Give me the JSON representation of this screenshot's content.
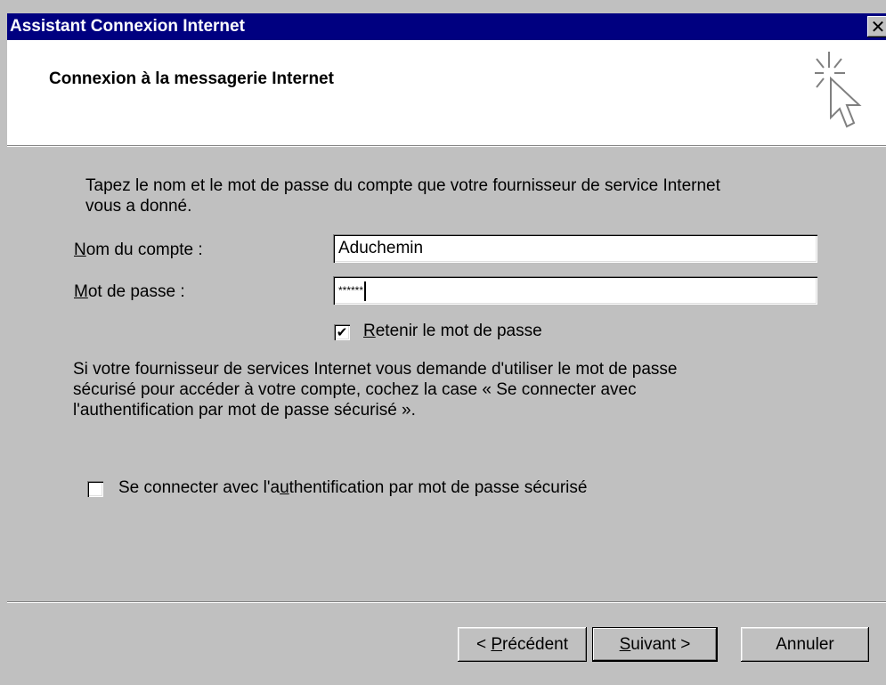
{
  "window": {
    "title": "Assistant Connexion Internet",
    "close_glyph": "✕"
  },
  "header": {
    "title": "Connexion à la messagerie Internet",
    "icon": "wizard-cursor-icon"
  },
  "content": {
    "intro": "Tapez le nom et le mot de passe du compte que votre fournisseur de service Internet\nvous a donné.",
    "account_label_mnemonic": "N",
    "account_label_rest": "om du compte :",
    "account_value": "Aduchemin",
    "password_label_mnemonic": "M",
    "password_label_rest": "ot de passe :",
    "password_value": "******",
    "remember_checked_glyph": "✔",
    "remember_label_mnemonic": "R",
    "remember_label_rest": "etenir le mot de passe",
    "remember_checked": true,
    "info": "Si votre fournisseur de services Internet vous demande d'utiliser le mot de passe\nsécurisé pour accéder à votre compte, cochez la case « Se connecter avec\nl'authentification par mot de passe sécurisé ».",
    "secure_label_pre": "Se connecter avec l'a",
    "secure_label_mnemonic": "u",
    "secure_label_post": "thentification par mot de passe sécurisé",
    "secure_checked": false
  },
  "footer": {
    "prev_pre": "< ",
    "prev_mnemonic": "P",
    "prev_post": "récédent",
    "next_mnemonic": "S",
    "next_post": "uivant >",
    "cancel_label": "Annuler"
  },
  "colors": {
    "titlebar": "#000080",
    "face": "#c0c0c0",
    "header_bg": "#ffffff"
  }
}
